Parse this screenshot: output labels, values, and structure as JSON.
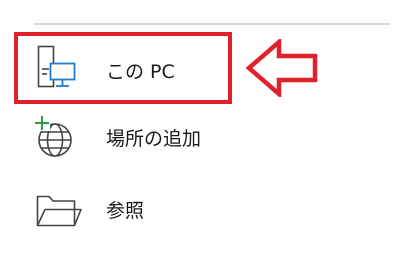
{
  "backstage_nav": {
    "items": [
      {
        "label": "この PC",
        "icon": "this-pc-icon"
      },
      {
        "label": "場所の追加",
        "icon": "add-place-globe-icon"
      },
      {
        "label": "参照",
        "icon": "folder-icon"
      }
    ]
  },
  "annotation": {
    "highlight_color": "#e0202a",
    "arrow_color": "#e0202a",
    "arrow_direction": "left"
  },
  "colors": {
    "monitor_accent": "#1e7bd0",
    "add_plus": "#2e9b49",
    "icon_stroke": "#444444",
    "divider": "#d4d4d4"
  }
}
